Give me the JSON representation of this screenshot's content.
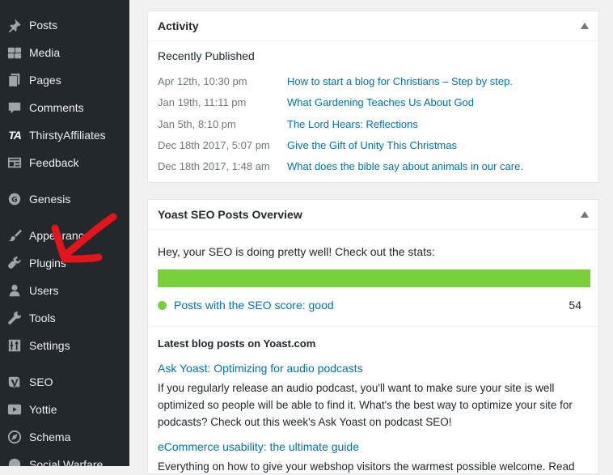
{
  "sidebar": {
    "items": [
      {
        "label": "Posts",
        "icon": "pushpin-icon"
      },
      {
        "label": "Media",
        "icon": "media-icon"
      },
      {
        "label": "Pages",
        "icon": "pages-icon"
      },
      {
        "label": "Comments",
        "icon": "comment-icon"
      },
      {
        "label": "ThirstyAffiliates",
        "icon": "thirstyaffiliates-icon",
        "glyph": "TA"
      },
      {
        "label": "Feedback",
        "icon": "feedback-icon"
      },
      {
        "label": "Genesis",
        "icon": "genesis-icon"
      },
      {
        "label": "Appearance",
        "icon": "paintbrush-icon"
      },
      {
        "label": "Plugins",
        "icon": "plugin-icon"
      },
      {
        "label": "Users",
        "icon": "users-icon"
      },
      {
        "label": "Tools",
        "icon": "wrench-icon"
      },
      {
        "label": "Settings",
        "icon": "settings-icon"
      },
      {
        "label": "SEO",
        "icon": "yoast-icon"
      },
      {
        "label": "Yottie",
        "icon": "youtube-icon"
      },
      {
        "label": "Schema",
        "icon": "compass-icon"
      },
      {
        "label": "Social Warfare",
        "icon": "social-warfare-icon"
      }
    ]
  },
  "activity": {
    "title": "Activity",
    "section_title": "Recently Published",
    "rows": [
      {
        "date": "Apr 12th, 10:30 pm",
        "title": "How to start a blog for Christians – Step by step."
      },
      {
        "date": "Jan 19th, 11:11 pm",
        "title": "What Gardening Teaches Us About God"
      },
      {
        "date": "Jan 5th, 8:10 pm",
        "title": "The Lord Hears: Reflections"
      },
      {
        "date": "Dec 18th 2017, 5:07 pm",
        "title": "Give the Gift of Unity This Christmas"
      },
      {
        "date": "Dec 18th 2017, 1:48 am",
        "title": "What does the bible say about animals in our care."
      }
    ]
  },
  "yoast": {
    "title": "Yoast SEO Posts Overview",
    "status_text": "Hey, your SEO is doing pretty well! Check out the stats:",
    "score_label_prefix": "Posts with the SEO score: ",
    "score_label_value": "good",
    "score_count": "54",
    "bar_fill_fraction": 1.0,
    "latest_title": "Latest blog posts on Yoast.com",
    "posts": [
      {
        "title": "Ask Yoast: Optimizing for audio podcasts",
        "excerpt": "If you regularly release an audio podcast, you'll want to make sure your site is well optimized so people will be able to find it. What's the best way to optimize your site for podcasts? Check out this week's Ask Yoast on podcast SEO!"
      },
      {
        "title": "eCommerce usability: the ultimate guide",
        "excerpt": "Everything on how to give your webshop visitors the warmest possible welcome. Read"
      }
    ]
  },
  "colors": {
    "sidebar_bg": "#23282d",
    "link": "#0073aa",
    "seo_good": "#7ad03a",
    "annotation_arrow": "#e3141b"
  }
}
